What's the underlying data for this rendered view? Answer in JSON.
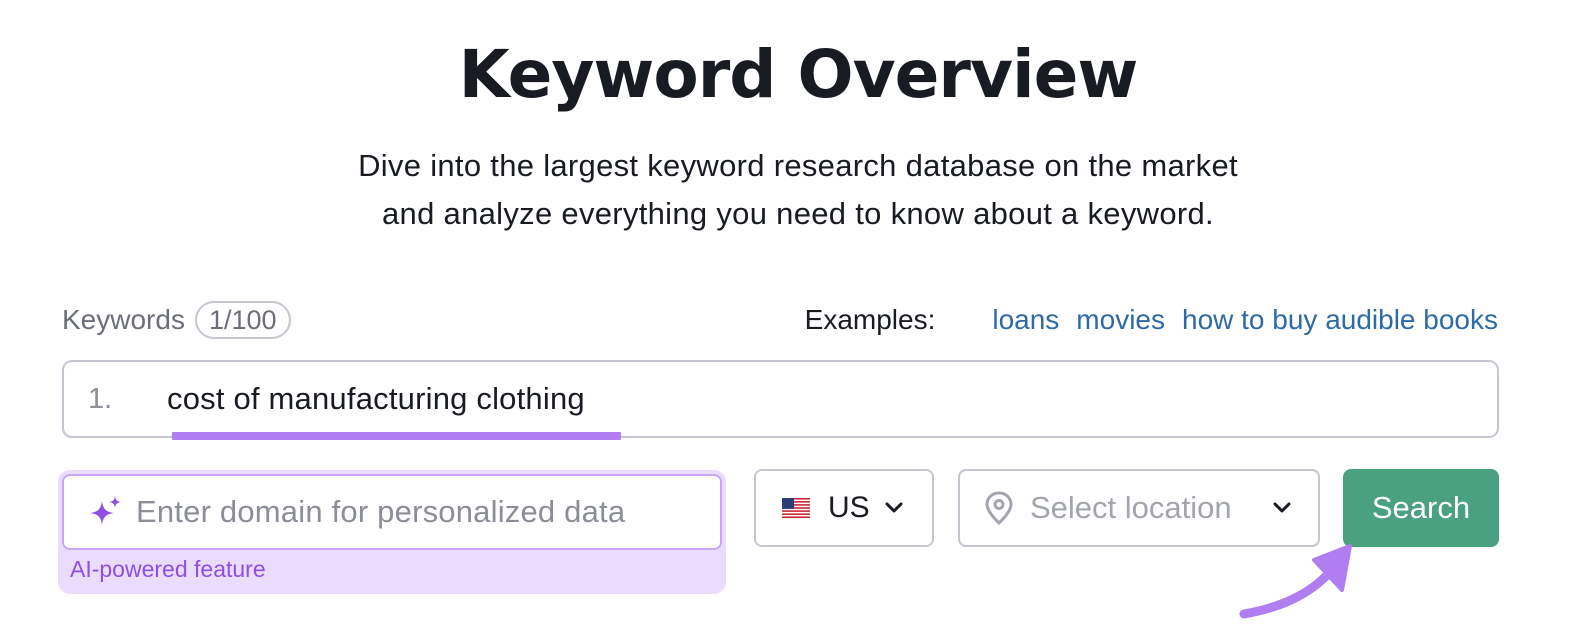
{
  "header": {
    "title": "Keyword Overview",
    "subtitle_line1": "Dive into the largest keyword research database on the market",
    "subtitle_line2": "and analyze everything you need to know about a keyword."
  },
  "keywords": {
    "label": "Keywords",
    "count": "1/100",
    "items": [
      {
        "number": "1.",
        "value": "cost of manufacturing clothing"
      }
    ]
  },
  "examples": {
    "label": "Examples:",
    "links": [
      "loans",
      "movies",
      "how to buy audible books"
    ]
  },
  "domain_input": {
    "placeholder": "Enter domain for personalized data",
    "note": "AI-powered feature"
  },
  "country": {
    "code": "US"
  },
  "location": {
    "placeholder": "Select location"
  },
  "search_button": {
    "label": "Search"
  },
  "colors": {
    "accent_purple": "#b07ef0",
    "search_green": "#4aa17f",
    "link_blue": "#2e6aa6",
    "ai_background": "#eadcfc"
  },
  "icons": {
    "spark": "sparkle-icon",
    "flag": "us-flag-icon",
    "pin": "location-pin-icon",
    "chevron": "chevron-down-icon",
    "arrow": "pointer-arrow-icon"
  }
}
